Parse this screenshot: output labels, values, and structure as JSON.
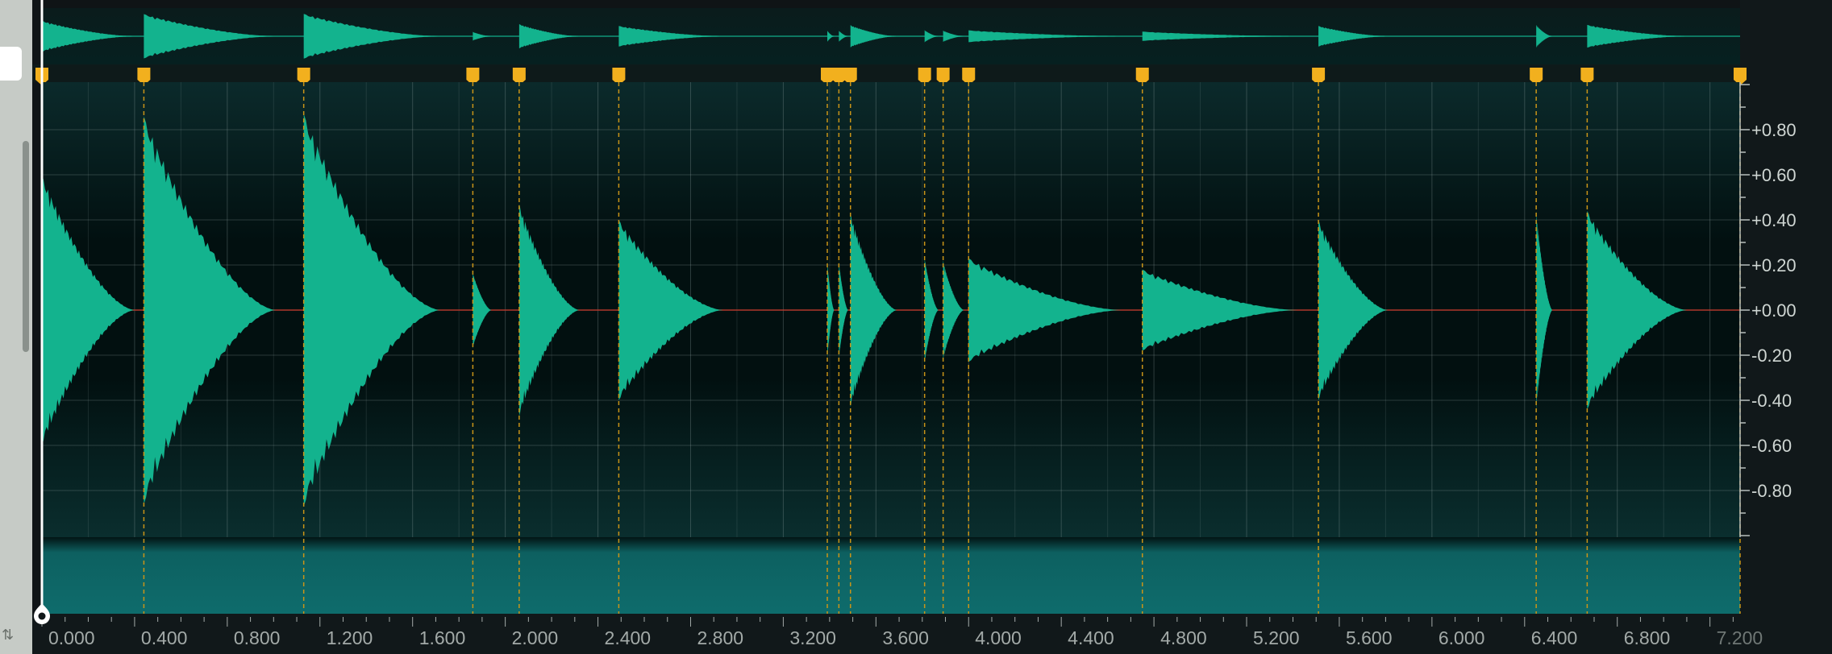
{
  "app": {
    "panel": "waveform-editor",
    "colors": {
      "background": "#020808",
      "waveform": "#13b38e",
      "marker": "#f2b01e",
      "marker_line": "#c99418",
      "sidebar": "#c6cbc6",
      "ruler_text": "#a3aaa8"
    }
  },
  "sidebar": {
    "glyph": "⇅",
    "icons": [
      "sort-arrows-icon"
    ]
  },
  "timeline": {
    "start": 0,
    "end": 7.2,
    "labels": [
      "0.000",
      "0.400",
      "0.800",
      "1.200",
      "1.600",
      "2.000",
      "2.400",
      "2.800",
      "3.200",
      "3.600",
      "4.000",
      "4.400",
      "4.800",
      "5.200",
      "5.600",
      "6.000",
      "6.400",
      "6.800",
      "7.200"
    ],
    "playhead_time": 0
  },
  "amplitude_scale": {
    "labels": [
      "+0.80",
      "+0.60",
      "+0.40",
      "+0.20",
      "+0.00",
      "-0.20",
      "-0.40",
      "-0.60",
      "-0.80"
    ],
    "values": [
      0.8,
      0.6,
      0.4,
      0.2,
      0.0,
      -0.2,
      -0.4,
      -0.6,
      -0.8
    ]
  },
  "markers": [
    0.0,
    0.44,
    1.13,
    1.86,
    2.06,
    2.49,
    3.39,
    3.44,
    3.49,
    3.81,
    3.89,
    4.0,
    4.75,
    5.51,
    6.45,
    6.67,
    7.33
  ],
  "transients": [
    {
      "start": 0.0,
      "amp": 0.6,
      "length": 0.4
    },
    {
      "start": 0.44,
      "amp": 0.86,
      "length": 0.57
    },
    {
      "start": 1.13,
      "amp": 0.87,
      "length": 0.59
    },
    {
      "start": 1.86,
      "amp": 0.17,
      "length": 0.08
    },
    {
      "start": 2.06,
      "amp": 0.47,
      "length": 0.26
    },
    {
      "start": 2.49,
      "amp": 0.4,
      "length": 0.45
    },
    {
      "start": 3.39,
      "amp": 0.22,
      "length": 0.03
    },
    {
      "start": 3.44,
      "amp": 0.22,
      "length": 0.04
    },
    {
      "start": 3.49,
      "amp": 0.43,
      "length": 0.2
    },
    {
      "start": 3.81,
      "amp": 0.24,
      "length": 0.06
    },
    {
      "start": 3.89,
      "amp": 0.22,
      "length": 0.09
    },
    {
      "start": 4.0,
      "amp": 0.23,
      "length": 0.66
    },
    {
      "start": 4.75,
      "amp": 0.18,
      "length": 0.67
    },
    {
      "start": 5.51,
      "amp": 0.4,
      "length": 0.3
    },
    {
      "start": 6.45,
      "amp": 0.44,
      "length": 0.07
    },
    {
      "start": 6.67,
      "amp": 0.44,
      "length": 0.43
    }
  ]
}
